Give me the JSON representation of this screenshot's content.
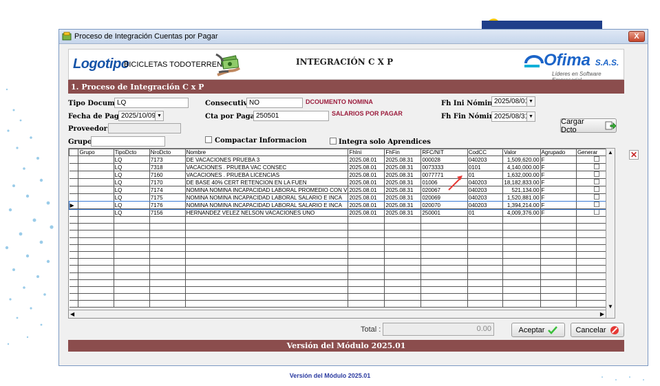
{
  "window": {
    "title": "Proceso de Integración Cuentas por Pagar",
    "close_label": "X"
  },
  "header": {
    "logo_text": "Logotipo",
    "company": "BICICLETAS TODOTERRENO",
    "title": "INTEGRACIÓN C X P",
    "brand_name": "Ofima",
    "brand_suffix": "S.A.S.",
    "brand_tagline": "Líderes en Software Empresarial",
    "money_icon": "money-hands-icon"
  },
  "section_title": "1. Proceso de Integración C x P",
  "form": {
    "tipo_documento_label": "Tipo Documento",
    "tipo_documento_value": "LQ",
    "consecutivo_label": "Consecutivo",
    "consecutivo_value": "NO",
    "consecutivo_note": "DCOUMENTO NOMINA",
    "fh_ini_label": "Fh Ini Nómina",
    "fh_ini_value": "2025/08/01",
    "fecha_pago_label": "Fecha de Pago",
    "fecha_pago_value": "2025/10/09",
    "cta_pagar_label": "Cta por Pagar:",
    "cta_pagar_value": "250501",
    "cta_pagar_note": "SALARIOS POR PAGAR",
    "fh_fin_label": "Fh Fin Nómina",
    "fh_fin_value": "2025/08/31",
    "proveedor_label": "Proveedor:",
    "proveedor_value": "",
    "grupo_label": "Grupo",
    "grupo_value": "",
    "compactar_label": "Compactar Informacion",
    "compactar_checked": false,
    "aprendices_label": "Integra solo Aprendices",
    "aprendices_checked": false,
    "cargar_label": "Cargar Dcto"
  },
  "grid": {
    "columns": [
      "Grupo",
      "TipoDcto",
      "NroDcto",
      "Nombre",
      "FhIni",
      "FhFin",
      "RFC/NIT",
      "CodCC",
      "Valor",
      "Agrupado",
      "Generar"
    ],
    "rows": [
      [
        "",
        "LQ",
        "7173",
        "DE VACACIONES PRUEBA 3",
        "2025.08.01",
        "2025.08.31",
        "000028",
        "040203",
        "1,509,620.00",
        "F",
        ""
      ],
      [
        "",
        "LQ",
        "7318",
        "VACACIONES . PRUEBA VAC CONSEC",
        "2025.08.01",
        "2025.08.31",
        "0073333",
        "0101",
        "4,140,000.00",
        "F",
        ""
      ],
      [
        "",
        "LQ",
        "7160",
        "VACACIONES . PRUEBA LICENCIAS",
        "2025.08.01",
        "2025.08.31",
        "0077771",
        "01",
        "1,632,000.00",
        "F",
        ""
      ],
      [
        "",
        "LQ",
        "7170",
        "DE BASE 40% CERT RETENCION EN LA FUEN",
        "2025.08.01",
        "2025.08.31",
        "01006",
        "040203",
        "18,182,833.00",
        "F",
        ""
      ],
      [
        "",
        "LQ",
        "7174",
        "NOMINA NOMINA INCAPACIDAD LABORAL PROMEDIO CON V",
        "2025.08.01",
        "2025.08.31",
        "020067",
        "040203",
        "521,134.00",
        "F",
        ""
      ],
      [
        "",
        "LQ",
        "7175",
        "NOMINA NOMINA INCAPACIDAD LABORAL SALARIO E INCA",
        "2025.08.01",
        "2025.08.31",
        "020069",
        "040203",
        "1,520,881.00",
        "F",
        ""
      ],
      [
        "",
        "LQ",
        "7176",
        "NOMINA NOMINA INCAPACIDAD LABORAL SALARIO E INCA",
        "2025.08.01",
        "2025.08.31",
        "020070",
        "040203",
        "1,394,214.00",
        "F",
        ""
      ],
      [
        "",
        "LQ",
        "7156",
        "HERNANDEZ VELEZ NELSON VACACIONES UNO",
        "2025.08.01",
        "2025.08.31",
        "250001",
        "01",
        "4,009,376.00",
        "F",
        ""
      ]
    ],
    "selected_row": 6,
    "current_row_marker": "▶"
  },
  "total": {
    "label": "Total :",
    "value": "0.00"
  },
  "buttons": {
    "aceptar": "Aceptar",
    "cancelar": "Cancelar"
  },
  "footer_version": "Versión del Módulo 2025.01",
  "page_version": "Versión del Módulo 2025.01",
  "colors": {
    "section_bar": "#8b4d4d",
    "note_red": "#9b1c3c",
    "brand_blue": "#1b64c8",
    "window_border": "#7a98c2"
  }
}
